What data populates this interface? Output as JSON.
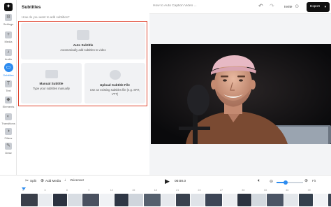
{
  "sidebar": {
    "items": [
      {
        "label": "Settings",
        "icon": "gear-icon",
        "glyph": "⚙"
      },
      {
        "label": "Media",
        "icon": "plus-icon",
        "glyph": "+"
      },
      {
        "label": "Audio",
        "icon": "music-note-icon",
        "glyph": "♪"
      },
      {
        "label": "Subtitles",
        "icon": "subtitles-icon",
        "glyph": "▭",
        "active": true
      },
      {
        "label": "Text",
        "icon": "text-icon",
        "glyph": "T"
      },
      {
        "label": "Elements",
        "icon": "shapes-icon",
        "glyph": "◆"
      },
      {
        "label": "Transitions",
        "icon": "transitions-icon",
        "glyph": "◐"
      },
      {
        "label": "Filters",
        "icon": "filters-icon",
        "glyph": "◑"
      },
      {
        "label": "Draw",
        "icon": "pencil-icon",
        "glyph": "✎"
      }
    ]
  },
  "panel": {
    "title": "Subtitles",
    "prompt": "How do you want to add subtitles?",
    "auto": {
      "title": "Auto Subtitle",
      "desc": "Automatically add subtitles to video"
    },
    "manual": {
      "title": "Manual Subtitle",
      "desc": "Type your subtitles manually"
    },
    "upload": {
      "title": "Upload Subtitle File",
      "desc": "Use an existing subtitles file (e.g. SRT, VTT)"
    }
  },
  "topbar": {
    "project_title": "How to Auto Caption Video ...",
    "undo_glyph": "↶",
    "redo_glyph": "↷",
    "invite_label": "Invite",
    "export_label": "Export",
    "export_chevron": "▾"
  },
  "timeline": {
    "split_label": "Split",
    "add_media_label": "Add Media",
    "voiceover_label": "Voiceover",
    "current_time": "00:00.0",
    "fit_label": "Fit",
    "zoom_level": 0.35,
    "ticks": [
      "0",
      "3",
      "6",
      "9",
      "12",
      "15",
      "18",
      "21",
      "24",
      "27",
      "30",
      "33",
      "36",
      "39"
    ],
    "thumb_colors": [
      "#3a3f4a",
      "#e9ecf0",
      "#2b3240",
      "#d8dde3",
      "#4a5160",
      "#f0f2f5",
      "#2f3745",
      "#cfd5dc",
      "#55606e",
      "#e6e9ed",
      "#39414e",
      "#dfe3e8",
      "#3d4656",
      "#eceef1",
      "#2c3340",
      "#d3d9df",
      "#4b5565",
      "#e3e7eb",
      "#34404d",
      "#f1f3f6",
      "#3a4452"
    ]
  },
  "colors": {
    "accent": "#2d8cf0",
    "highlight": "#e0452f"
  }
}
